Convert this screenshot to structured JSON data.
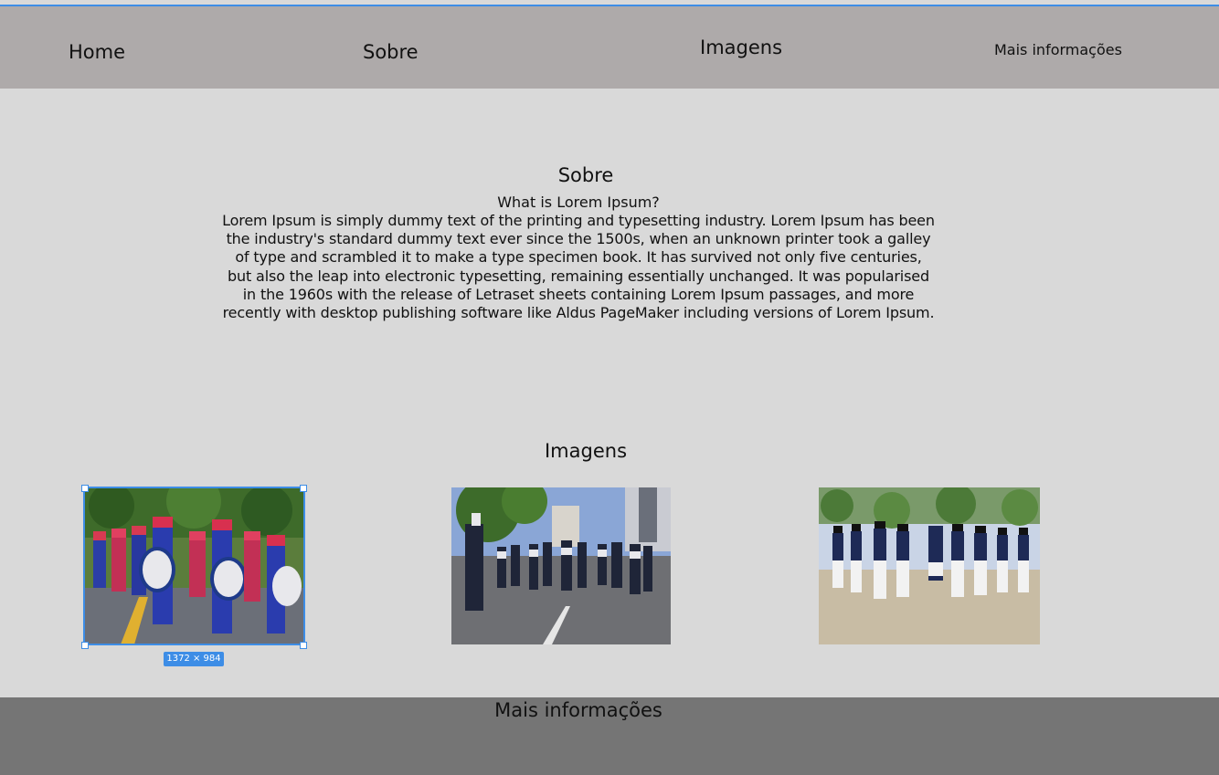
{
  "nav": {
    "home": "Home",
    "sobre": "Sobre",
    "imagens": "Imagens",
    "mais": "Mais informações"
  },
  "sobre": {
    "title": "Sobre",
    "lead": "What is Lorem Ipsum?",
    "body": "Lorem Ipsum is simply dummy text of the printing and typesetting industry. Lorem Ipsum has been the industry's standard dummy text ever since the 1500s, when an unknown printer took a galley of type and scrambled it to make a type specimen book. It has survived not only five centuries, but also the leap into electronic typesetting, remaining essentially unchanged. It was popularised in the 1960s with the release of Letraset sheets containing Lorem Ipsum passages, and more recently with desktop publishing software like Aldus PageMaker including versions of Lorem Ipsum."
  },
  "imagens": {
    "title": "Imagens",
    "selection_badge": "1372 × 984",
    "items": [
      {
        "subject": "marching band in red and blue uniforms with drums",
        "selected": true
      },
      {
        "subject": "marching band in dark uniforms on a city street"
      },
      {
        "subject": "marching band in white and navy uniforms in a plaza"
      }
    ]
  },
  "footer": {
    "title": "Mais informações"
  },
  "colors": {
    "accent": "#3d8de6",
    "navbar": "#aeaaaa",
    "page": "#d9d9d9",
    "footer": "#757575"
  }
}
